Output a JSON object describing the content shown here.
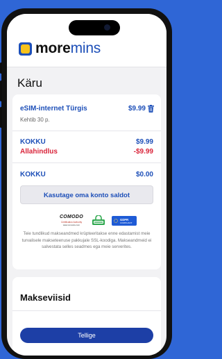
{
  "brand": {
    "more": "more",
    "mins": "mins"
  },
  "page_title": "Käru",
  "cart": {
    "item_name": "eSIM-internet Türgis",
    "item_price": "$9.99",
    "item_duration": "Kehtib 30 p.",
    "total_label": "KOKKU",
    "total_value": "$9.99",
    "discount_label": "Allahindlus",
    "discount_value": "-$9.99",
    "final_total_label": "KOKKU",
    "final_total_value": "$0.00",
    "balance_button": "Kasutage oma konto saldot"
  },
  "security": {
    "comodo_title": "COMODO",
    "comodo_sub": "Certification Authority",
    "comodo_url": "www.comodo.com",
    "gdpr_label": "GDPR",
    "gdpr_sub": "COMPLIANT",
    "text": "Teie tundlikud makseandmed krüpteeritakse enne edastamist meie turvalisele makseteenuse pakkujale SSL-koodiga. Makseandmeid ei salvestata selles seadmes ega meie serverites."
  },
  "payment": {
    "title": "Makseviisid",
    "order_button": "Tellige"
  },
  "colors": {
    "background": "#2f66d6",
    "accent_blue": "#1d4fb8",
    "order_button": "#1d3fa6",
    "discount_red": "#d9243a",
    "logo_yellow": "#f7c21b"
  },
  "icons": [
    "trash-icon",
    "ssl-lock-icon",
    "gdpr-star-icon",
    "logo-icon"
  ]
}
